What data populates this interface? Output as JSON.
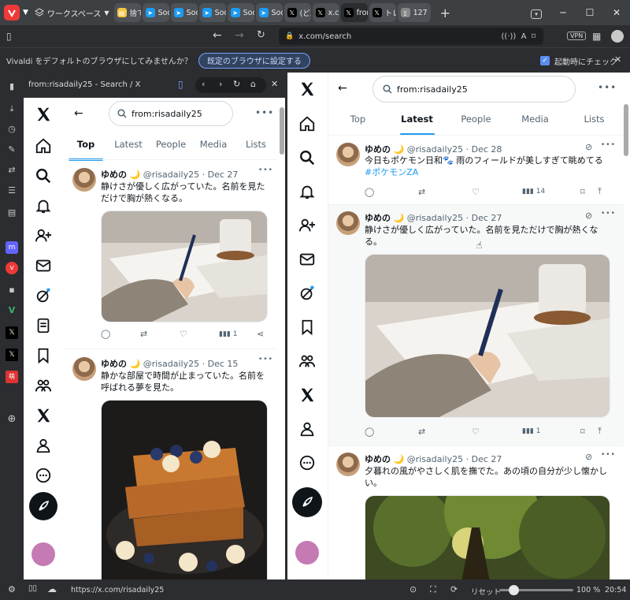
{
  "browser": {
    "workspace_label": "ワークスペース",
    "tabs": [
      {
        "label": "捨て",
        "icon": "folder-icon",
        "color": "#f4c542"
      },
      {
        "label": "Soci",
        "icon": "send-icon",
        "color": "#1d9bf0"
      },
      {
        "label": "Soci",
        "icon": "send-icon",
        "color": "#1d9bf0"
      },
      {
        "label": "Soci",
        "icon": "send-icon",
        "color": "#1d9bf0"
      },
      {
        "label": "Soci",
        "icon": "send-icon",
        "color": "#1d9bf0"
      },
      {
        "label": "Soci",
        "icon": "send-icon",
        "color": "#1d9bf0"
      },
      {
        "label": "(どん",
        "icon": "x-icon",
        "color": "#000000"
      },
      {
        "label": "x.co",
        "icon": "x-icon",
        "color": "#000000"
      },
      {
        "label": "from",
        "icon": "x-icon",
        "color": "#000000"
      },
      {
        "label": "トレン",
        "icon": "x-icon",
        "color": "#000000"
      },
      {
        "label": "127",
        "icon": "page-icon",
        "color": "#888888"
      }
    ],
    "url": "x.com/search",
    "vpn": "VPN",
    "notify_text": "Vivaldi をデフォルトのブラウザにしてみませんか？",
    "notify_button": "既定のブラウザに設定する",
    "notify_check_label": "起動時にチェック",
    "status_url": "https://x.com/risadaily25",
    "status_reset": "リセット",
    "zoom": "100 %",
    "clock": "20:54"
  },
  "panel1": {
    "title": "from:risadaily25 - Search / X",
    "search": "from:risadaily25",
    "tabs": [
      "Top",
      "Latest",
      "People",
      "Media",
      "Lists"
    ],
    "active_tab": 0,
    "tweets": [
      {
        "name": "ゆめの",
        "handle": "@risadaily25",
        "date": "Dec 27",
        "text": "静けさが優しく広がっていた。名前を見ただけで胸が熱くなる。",
        "views": "1"
      },
      {
        "name": "ゆめの",
        "handle": "@risadaily25",
        "date": "Dec 15",
        "text": "静かな部屋で時間が止まっていた。名前を呼ばれる夢を見た。",
        "views": ""
      }
    ]
  },
  "panel2": {
    "search": "from:risadaily25",
    "tabs": [
      "Top",
      "Latest",
      "People",
      "Media",
      "Lists"
    ],
    "active_tab": 1,
    "tweets": [
      {
        "name": "ゆめの",
        "handle": "@risadaily25",
        "date": "Dec 28",
        "text": "今日もポケモン日和🐾 雨のフィールドが美しすぎて眺めてる",
        "hashtag": "#ポケモンZA",
        "views": "14"
      },
      {
        "name": "ゆめの",
        "handle": "@risadaily25",
        "date": "Dec 27",
        "text": "静けさが優しく広がっていた。名前を見ただけで胸が熱くなる。",
        "hashtag": "",
        "views": "1"
      },
      {
        "name": "ゆめの",
        "handle": "@risadaily25",
        "date": "Dec 27",
        "text": "夕暮れの風がやさしく肌を撫でた。あの頃の自分が少し懐かしい。",
        "hashtag": "",
        "views": ""
      }
    ]
  },
  "colors": {
    "accent": "#1d9bf0",
    "vivaldi_red": "#ef3939",
    "chrome_dark": "#2b2d30"
  }
}
